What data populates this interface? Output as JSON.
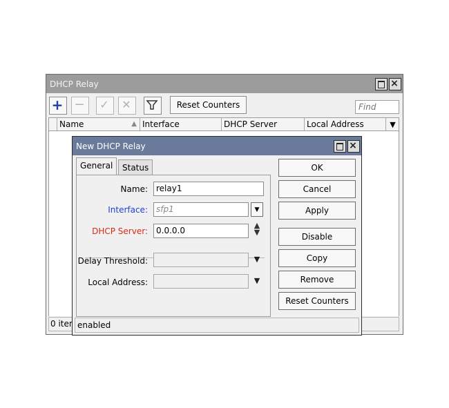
{
  "main_window": {
    "title": "DHCP Relay",
    "reset_counters_label": "Reset Counters",
    "find_placeholder": "Find",
    "columns": [
      "Name",
      "Interface",
      "DHCP Server",
      "Local Address"
    ],
    "status_text": "0 item"
  },
  "dialog": {
    "title": "New DHCP Relay",
    "tabs": [
      "General",
      "Status"
    ],
    "fields": {
      "name": {
        "label": "Name:",
        "value": "relay1"
      },
      "interface": {
        "label": "Interface:",
        "value": "sfp1"
      },
      "dhcp_server": {
        "label": "DHCP Server:",
        "value": "0.0.0.0"
      },
      "delay_threshold": {
        "label": "Delay Threshold:",
        "value": ""
      },
      "local_address": {
        "label": "Local Address:",
        "value": ""
      }
    },
    "buttons": {
      "ok": "OK",
      "cancel": "Cancel",
      "apply": "Apply",
      "disable": "Disable",
      "copy": "Copy",
      "remove": "Remove",
      "reset_counters": "Reset Counters"
    },
    "status_text": "enabled"
  },
  "colors": {
    "interface_label": "#1a3fd6",
    "dhcp_server_label": "#d62a1a",
    "add_icon": "#1d3fa8"
  },
  "icons": [
    "add-icon",
    "remove-icon",
    "enable-icon",
    "disable-icon",
    "filter-icon",
    "sort-arrow-icon",
    "dropdown-icon",
    "spinner-icon",
    "restore-icon",
    "close-icon"
  ]
}
